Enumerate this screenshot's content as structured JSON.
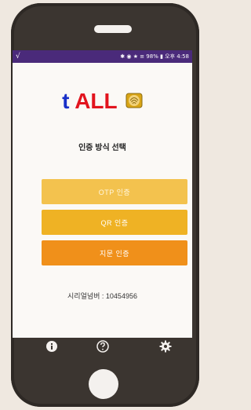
{
  "statusbar": {
    "left_glyph": "√",
    "right_text": "✱ ◉ ★ ≡ 98% ▮ 오후 4:58"
  },
  "logo": {
    "t": "t",
    "all": "ALL"
  },
  "subtitle": "인증 방식 선택",
  "buttons": {
    "otp": "OTP 인증",
    "qr": "QR 인증",
    "finger": "지문 인증"
  },
  "serial": "시리얼넘버 : 10454956",
  "colors": {
    "statusbar": "#4a2a7a",
    "otp": "#f3c24e",
    "qr": "#efb224",
    "finger": "#f0901a",
    "logo_t": "#1830c8",
    "logo_all": "#e2141e"
  },
  "icons": [
    "info-icon",
    "help-icon",
    "settings-icon"
  ]
}
